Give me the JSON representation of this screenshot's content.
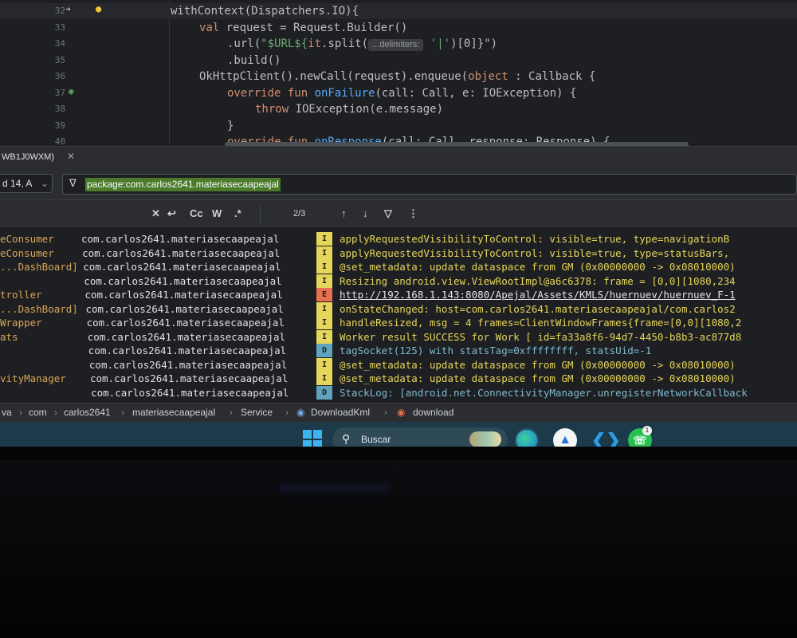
{
  "editor": {
    "lines": [
      {
        "num": "32",
        "parts": [
          [
            "withContext(Dispatchers.IO){",
            "plain"
          ]
        ]
      },
      {
        "num": "33",
        "parts": [
          [
            "val ",
            "kw"
          ],
          [
            "request = Request.Builder()",
            "plain"
          ]
        ]
      },
      {
        "num": "34",
        "parts": [
          [
            ".url(",
            "plain"
          ],
          [
            "\"$URL${",
            "str"
          ],
          [
            "it",
            "kw"
          ],
          [
            ".split(",
            "plain"
          ]
        ],
        "hint": "...delimiters:",
        "after": [
          [
            " '|'",
            "str"
          ],
          [
            ")[0]}\")",
            "plain"
          ]
        ]
      },
      {
        "num": "35",
        "parts": [
          [
            ".build()",
            "plain"
          ]
        ]
      },
      {
        "num": "36",
        "parts": [
          [
            "OkHttpClient().newCall(request).enqueue(",
            "plain"
          ],
          [
            "object",
            "kw"
          ],
          [
            " : Callback {",
            "plain"
          ]
        ]
      },
      {
        "num": "37",
        "parts": [
          [
            "override fun ",
            "kw"
          ],
          [
            "onFailure",
            "fn"
          ],
          [
            "(call: Call, e: IOException) {",
            "plain"
          ]
        ]
      },
      {
        "num": "38",
        "parts": [
          [
            "throw ",
            "kw"
          ],
          [
            "IOException(e.message)",
            "plain"
          ]
        ]
      },
      {
        "num": "39",
        "parts": [
          [
            "}",
            "plain"
          ]
        ]
      },
      {
        "num": "40",
        "parts": [
          [
            "override fun ",
            "kw"
          ],
          [
            "onResponse",
            "fn"
          ],
          [
            "(call: Call, response: Response) {",
            "plain"
          ]
        ]
      }
    ]
  },
  "logcat": {
    "tab_label": "WB1J0WXM)",
    "device_select": "d 14, A",
    "filter_value": "package:com.carlos2641.materiasecaapeajal",
    "match_count": "2/3",
    "toolbar": {
      "cc": "Cc",
      "w": "W",
      "regex": ".*"
    },
    "rows": [
      {
        "tag": "eConsumer",
        "pkg": "com.carlos2641.materiasecaapeajal",
        "level": "I",
        "msg": "applyRequestedVisibilityToControl: visible=true, type=navigationB"
      },
      {
        "tag": "eConsumer",
        "pkg": "com.carlos2641.materiasecaapeajal",
        "level": "I",
        "msg": "applyRequestedVisibilityToControl: visible=true, type=statusBars,"
      },
      {
        "tag": "...DashBoard]",
        "pkg": "com.carlos2641.materiasecaapeajal",
        "level": "I",
        "msg": "@set_metadata: update dataspace from GM (0x00000000 -> 0x08010000)"
      },
      {
        "tag": "",
        "pkg": "com.carlos2641.materiasecaapeajal",
        "level": "I",
        "msg": "Resizing android.view.ViewRootImpl@a6c6378: frame = [0,0][1080,234"
      },
      {
        "tag": "troller",
        "pkg": "com.carlos2641.materiasecaapeajal",
        "level": "E",
        "msg": "http://192.168.1.143:8080/Apejal/Assets/KMLS/huernuev/huernuev_F-1"
      },
      {
        "tag": "...DashBoard]",
        "pkg": "com.carlos2641.materiasecaapeajal",
        "level": "I",
        "msg": "onStateChanged: host=com.carlos2641.materiasecaapeajal/com.carlos2"
      },
      {
        "tag": "Wrapper",
        "pkg": "com.carlos2641.materiasecaapeajal",
        "level": "I",
        "msg": "handleResized, msg = 4 frames=ClientWindowFrames{frame=[0,0][1080,2"
      },
      {
        "tag": "ats",
        "pkg": "com.carlos2641.materiasecaapeajal",
        "level": "I",
        "msg": "Worker result SUCCESS for Work [ id=fa33a8f6-94d7-4450-b8b3-ac877d8"
      },
      {
        "tag": "",
        "pkg": "com.carlos2641.materiasecaapeajal",
        "level": "D",
        "msg": "tagSocket(125) with statsTag=0xffffffff, statsUid=-1"
      },
      {
        "tag": "",
        "pkg": "com.carlos2641.materiasecaapeajal",
        "level": "I",
        "msg": "@set_metadata: update dataspace from GM (0x00000000 -> 0x08010000)"
      },
      {
        "tag": "vityManager",
        "pkg": "com.carlos2641.materiasecaapeajal",
        "level": "I",
        "msg": "@set_metadata: update dataspace from GM (0x00000000 -> 0x08010000)"
      },
      {
        "tag": "",
        "pkg": "com.carlos2641.materiasecaapeajal",
        "level": "D",
        "msg": "StackLog: [android.net.ConnectivityManager.unregisterNetworkCallback"
      }
    ],
    "level_colors": {
      "I": "#e6d65a",
      "D": "#5fa3bf",
      "E": "#e76f4f"
    }
  },
  "breadcrumb": {
    "items": [
      "va",
      "com",
      "carlos2641",
      "materiasecaapeajal",
      "Service",
      "DownloadKml",
      "download"
    ]
  },
  "taskbar": {
    "search_label": "Buscar",
    "whatsapp_badge": "1",
    "apps": [
      "start",
      "edge",
      "app-a",
      "vscode",
      "whatsapp"
    ]
  }
}
